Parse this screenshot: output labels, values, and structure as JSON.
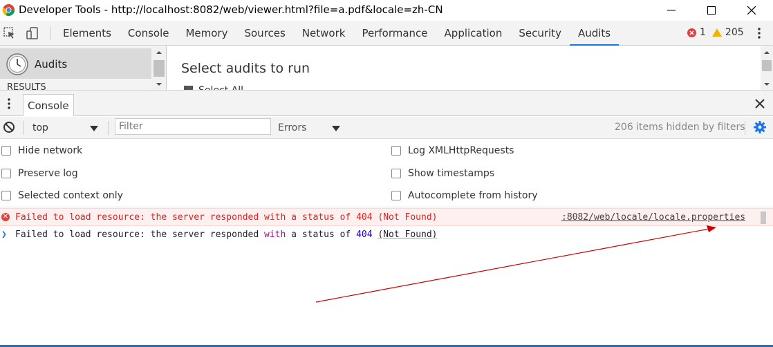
{
  "window": {
    "title": "Developer Tools - http://localhost:8082/web/viewer.html?file=a.pdf&locale=zh-CN",
    "icon": "chrome-logo-icon",
    "controls": [
      "minimize-icon",
      "maximize-icon",
      "close-icon"
    ]
  },
  "toolbar": {
    "tabs": [
      "Elements",
      "Console",
      "Memory",
      "Sources",
      "Network",
      "Performance",
      "Application",
      "Security",
      "Audits"
    ],
    "active_tab": "Audits",
    "error_count": "1",
    "warning_count": "205"
  },
  "audits": {
    "sidebar_item": "Audits",
    "results_label": "RESULTS",
    "heading": "Select audits to run",
    "select_all": "Select All"
  },
  "drawer": {
    "tab_label": "Console"
  },
  "console": {
    "context": "top",
    "filter_placeholder": "Filter",
    "level": "Errors",
    "hidden_items": "206 items hidden by filters"
  },
  "settings": {
    "left": [
      "Hide network",
      "Preserve log",
      "Selected context only"
    ],
    "right": [
      "Log XMLHttpRequests",
      "Show timestamps",
      "Autocomplete from history"
    ]
  },
  "messages": {
    "error": {
      "text": "Failed to load resource: the server responded with a status of 404 (Not Found)",
      "source": ":8082/web/locale/locale.properties"
    },
    "input": {
      "part1": "Failed to load resource: the server responded ",
      "kw": "with",
      "part2": " a status of ",
      "num": "404",
      "part3": " ",
      "paren": "(Not Found)"
    }
  },
  "colors": {
    "accent": "#1a73e8",
    "error": "#e02020",
    "error_bg": "#fff0f0",
    "warning": "#f0b400",
    "annotation": "#cc0000"
  }
}
